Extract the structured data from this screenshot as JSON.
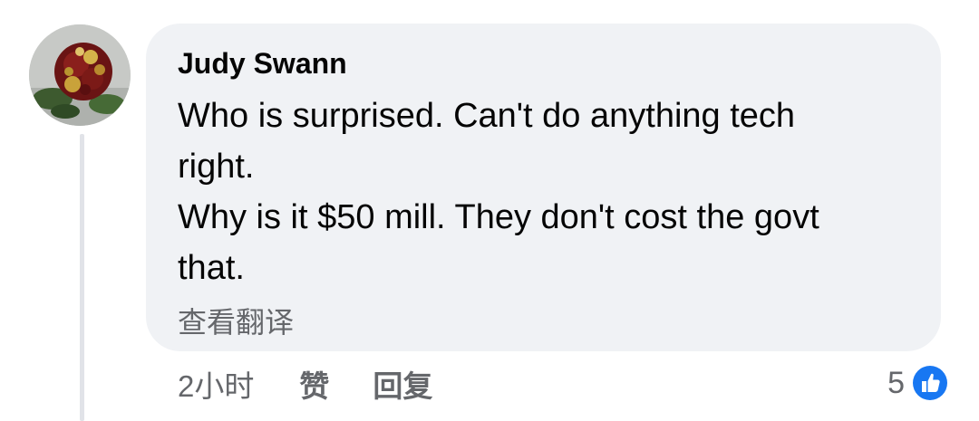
{
  "comment": {
    "author": "Judy Swann",
    "lines": [
      "Who is surprised. Can't do anything tech",
      "right.",
      "Why is it $50 mill. They don't cost the govt",
      "that."
    ],
    "translate_label": "查看翻译"
  },
  "actions": {
    "time": "2小时",
    "like_label": "赞",
    "reply_label": "回复"
  },
  "reactions": {
    "count": "5",
    "icon": "thumbs-up-icon",
    "color": "#1877f2"
  }
}
